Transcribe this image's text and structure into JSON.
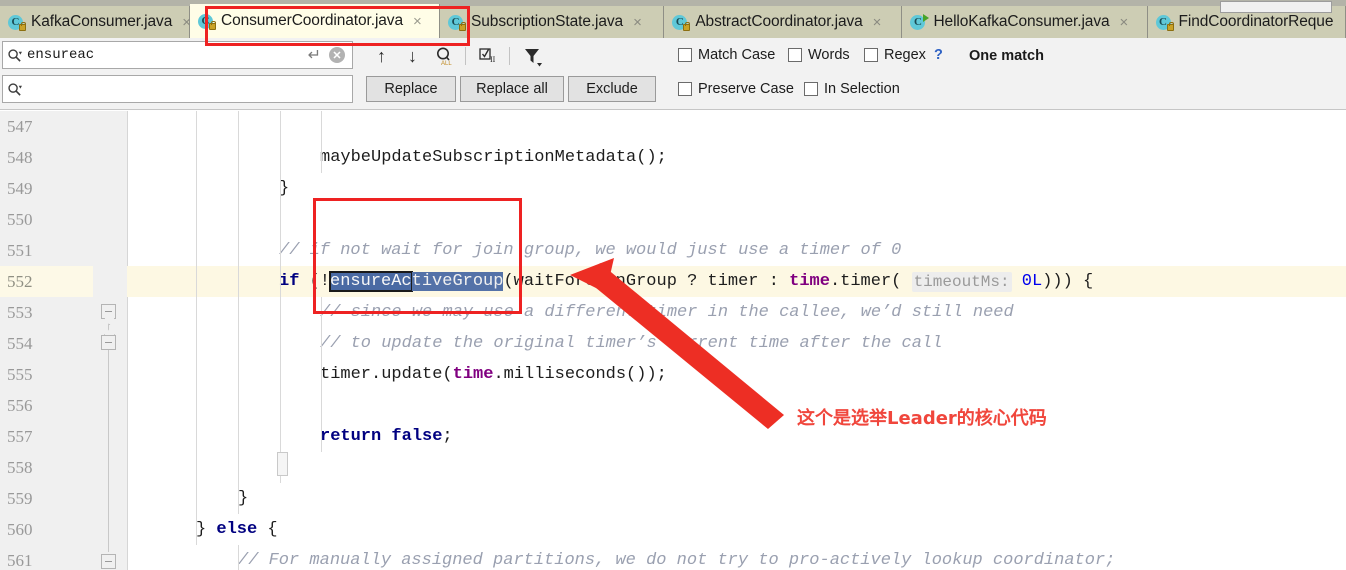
{
  "tabs": [
    {
      "label": "KafkaConsumer.java",
      "icon": "java-class-locked-icon",
      "active": false,
      "close": "×"
    },
    {
      "label": "ConsumerCoordinator.java",
      "icon": "java-class-locked-icon",
      "active": true,
      "close": "×"
    },
    {
      "label": "SubscriptionState.java",
      "icon": "java-class-locked-icon",
      "active": false,
      "close": "×"
    },
    {
      "label": "AbstractCoordinator.java",
      "icon": "java-class-locked-icon",
      "active": false,
      "close": "×"
    },
    {
      "label": "HelloKafkaConsumer.java",
      "icon": "java-class-runnable-icon",
      "active": false,
      "close": "×"
    },
    {
      "label": "FindCoordinatorReque",
      "icon": "java-class-locked-icon",
      "active": false,
      "close": ""
    }
  ],
  "find": {
    "search_value": "ensureac",
    "search_placeholder": "",
    "replace_value": "",
    "replace_placeholder": "",
    "icons": {
      "search_magnifier": "search-icon",
      "return": "↵",
      "clear": "✕",
      "prev": "↑",
      "next": "↓",
      "find_all": "find-all-icon",
      "select_all_occurrences": "select-all-occurrences-icon",
      "filter": "filter-icon"
    },
    "buttons": {
      "replace": "Replace",
      "replace_all": "Replace all",
      "exclude": "Exclude"
    },
    "checkboxes": {
      "match_case": "Match Case",
      "words": "Words",
      "regex": "Regex",
      "preserve_case": "Preserve Case",
      "in_selection": "In Selection"
    },
    "help": "?",
    "match_count": "One match"
  },
  "editor": {
    "first_line_number": 547,
    "current_line": 552,
    "lines": [
      {
        "no": 547,
        "indent_guides": [
          0,
          1,
          2,
          3
        ],
        "text": ""
      },
      {
        "no": 548,
        "indent_guides": [
          0,
          1,
          2,
          3
        ],
        "text": "            maybeUpdateSubscriptionMetadata();"
      },
      {
        "no": 549,
        "indent_guides": [
          0,
          1,
          2
        ],
        "text": "        }"
      },
      {
        "no": 550,
        "indent_guides": [
          0,
          1,
          2
        ],
        "text": ""
      },
      {
        "no": 551,
        "indent_guides": [
          0,
          1,
          2
        ],
        "text": "        // if not wait for join group, we would just use a timer of 0"
      },
      {
        "no": 552,
        "indent_guides": [
          0,
          1,
          2
        ],
        "text": "        if (!ensureActiveGroup(waitForJoinGroup ? timer : time.timer( timeoutMs: 0L))) {"
      },
      {
        "no": 553,
        "indent_guides": [
          0,
          1,
          2,
          3
        ],
        "text": "            // since we may use a different timer in the callee, we'd still need"
      },
      {
        "no": 554,
        "indent_guides": [
          0,
          1,
          2,
          3
        ],
        "text": "            // to update the original timer's current time after the call"
      },
      {
        "no": 555,
        "indent_guides": [
          0,
          1,
          2,
          3
        ],
        "text": "            timer.update(time.milliseconds());"
      },
      {
        "no": 556,
        "indent_guides": [
          0,
          1,
          2,
          3
        ],
        "text": ""
      },
      {
        "no": 557,
        "indent_guides": [
          0,
          1,
          2,
          3
        ],
        "text": "            return false;"
      },
      {
        "no": 558,
        "indent_guides": [
          0,
          1,
          2
        ],
        "text": "        }"
      },
      {
        "no": 559,
        "indent_guides": [
          0,
          1
        ],
        "text": "    }"
      },
      {
        "no": 560,
        "indent_guides": [
          0
        ],
        "text": "} else {"
      },
      {
        "no": 561,
        "indent_guides": [
          0,
          1
        ],
        "text": "    // For manually assigned partitions, we do not try to pro-actively lookup coordinator;"
      }
    ],
    "selection": {
      "matched_text": "ensureAc",
      "selected_text": "ensureActiveGroup"
    },
    "parameter_hint": "timeoutMs:"
  },
  "annotations": {
    "note_cn": "这个是选举Leader的核心代码",
    "highlight_color": "#ee2222",
    "note_color": "#f0463c"
  }
}
